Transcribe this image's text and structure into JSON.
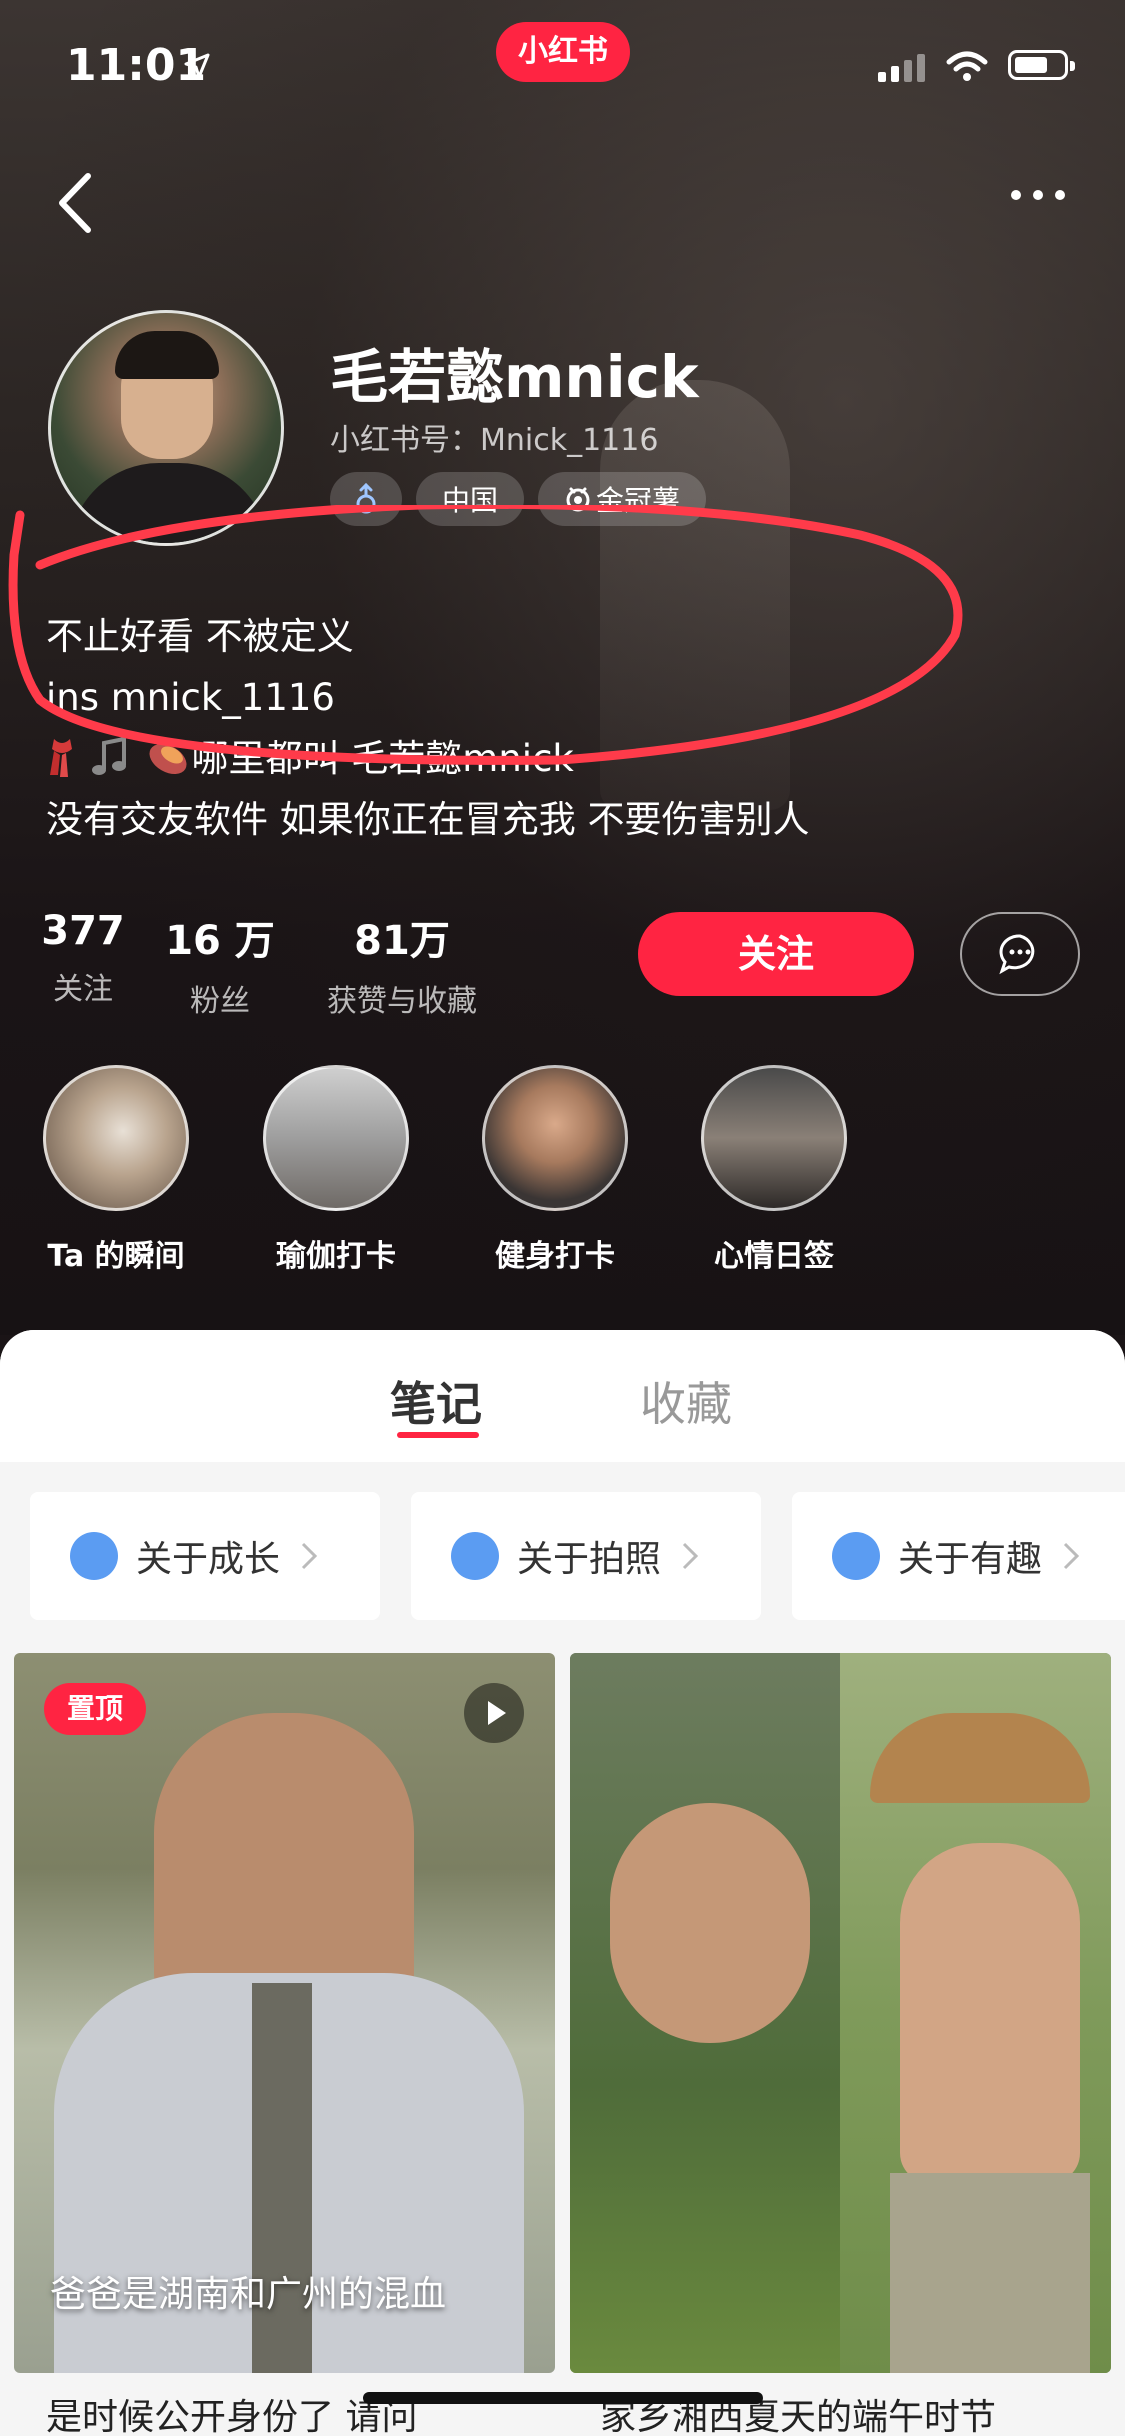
{
  "status_bar": {
    "time": "11:01",
    "app_badge": "小红书"
  },
  "profile": {
    "username": "毛若懿mnick",
    "user_id": "小红书号：Mnick_1116",
    "tags": [
      "中国",
      "金冠薯"
    ],
    "bio": [
      "不止好看  不被定义",
      "ins mnick_1116",
      "哪里都叫 毛若懿mnick",
      "没有交友软件 如果你正在冒充我 不要伤害别人"
    ]
  },
  "stats": [
    {
      "value": "377",
      "label": "关注"
    },
    {
      "value": "16 万",
      "label": "粉丝"
    },
    {
      "value": "81万",
      "label": "获赞与收藏"
    }
  ],
  "actions": {
    "follow_label": "关注"
  },
  "highlights": [
    "Ta 的瞬间",
    "瑜伽打卡",
    "健身打卡",
    "心情日签"
  ],
  "tabs": {
    "notes": "笔记",
    "favorites": "收藏"
  },
  "albums": [
    "关于成长",
    "关于拍照",
    "关于有趣"
  ],
  "posts": [
    {
      "badge": "置顶",
      "caption": "爸爸是湖南和广州的混血",
      "title": "是时候公开身份了 请问"
    },
    {
      "title": "家乡湘西夏天的端午时节"
    }
  ],
  "colors": {
    "accent": "#ff2442",
    "annotation": "#ff3b4a"
  }
}
